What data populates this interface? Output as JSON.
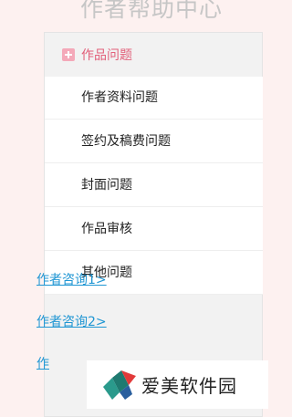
{
  "page": {
    "title": "作者帮助中心"
  },
  "category": {
    "label": "作品问题",
    "items": [
      "作者资料问题",
      "签约及稿费问题",
      "封面问题",
      "作品审核",
      "其他问题"
    ]
  },
  "links": [
    "作者咨询1>",
    "作者咨询2>",
    "作"
  ],
  "colors": {
    "accent": "#e2607a",
    "link": "#1f96d3",
    "background": "#fdf1f0"
  },
  "watermark": {
    "text": "爱美软件园"
  }
}
